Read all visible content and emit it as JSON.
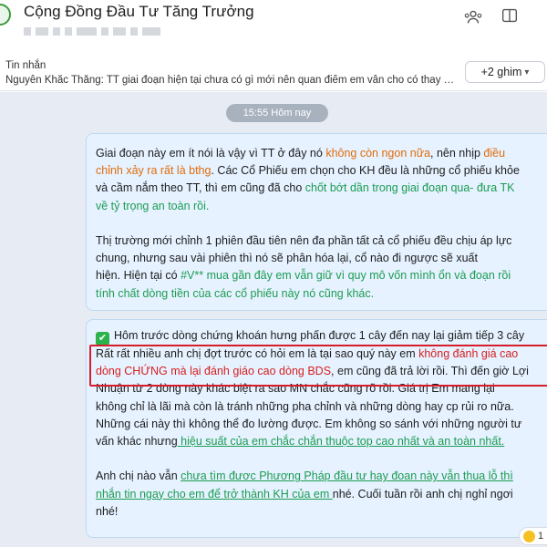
{
  "header": {
    "title": "Cộng Đồng Đầu Tư Tăng Trưởng"
  },
  "pinned": {
    "label": "Tin nhắn",
    "message": "Nguyễn Khắc Thắng: TT giai đoạn hiện tại chưa có gì mới nên quan điểm em vẫn cho có thay đổi....",
    "pin_count_label": "+2 ghim"
  },
  "chat": {
    "timestamp": "15:55 Hôm nay",
    "message1": {
      "l1_a": "Giai đoạn này em ít nói là vậy vì TT ở đây nó ",
      "l1_b": "không còn ngon nữa",
      "l1_c": ", nên nhịp ",
      "l1_d": "điều",
      "l2_a": "chỉnh xảy ra rất là bthg",
      "l2_b": ". Các Cổ Phiếu em chọn cho KH đều là những cổ phiếu khỏe",
      "l3_a": "và cầm nắm theo TT, thì em cũng đã cho ",
      "l3_b": "chốt bớt dần trong giai đoạn qua- đưa TK",
      "l4": "về tỷ trọng an toàn rồi.",
      "l5": "Thị trường mới chỉnh 1 phiên đầu tiên nên đa phần tất cả cổ phiếu đều chịu áp lực",
      "l6": "chung, nhưng sau vài phiên thì nó sẽ phân hóa lại, cổ nào đi ngược sẽ xuất",
      "l7_a": "hiện. Hiện tại có ",
      "l7_b": "#V** mua gần đây em vẫn giữ vì quy mô vốn mình ổn và đoạn rồi",
      "l8": "tính chất dòng tiền của các cổ phiếu này nó cũng khác."
    },
    "message2": {
      "l1": "Hôm trước dòng chứng khoán hưng phấn được 1 cây đến nay lại giảm tiếp 3 cây",
      "l2_a": "Rất rất nhiều anh chị đợt trước có hỏi em là tại sao quý này em ",
      "l2_b": "không đánh giá cao",
      "l3_a": "dòng CHỨNG mà lại đánh giáo cao dòng BDS",
      "l3_b": ", em cũng đã trả lời rồi. Thì đến giờ Lợi",
      "l4": "Nhuận từ 2 dòng này khác biệt ra sao MN chắc cũng rõ rồi. Giá trị Em mang lại",
      "l5": "không chỉ là lãi mà còn là tránh những pha chỉnh và những dòng hay cp rủi ro nữa.",
      "l6": "Những cái này thì không thể đo lường được. Em không so sánh với những người tư",
      "l7_a": "vấn khác nhưng",
      "l7_b": " hiệu suất của em chắc chắn thuộc top cao nhất và an toàn nhất.",
      "l8_a": "Anh chị nào vẫn ",
      "l8_b": "chưa tìm được Phương Pháp đầu tư hay đoạn này vẫn thua lỗ thì",
      "l9_a": "nhắn tin ngay cho em để trở thành KH của em ",
      "l9_b": "nhé. Cuối tuần rồi anh chị nghỉ ngơi",
      "l10": "nhé!"
    },
    "reaction_count": "1"
  },
  "colors": {
    "bubble_bg": "#e6f2ff",
    "chat_bg": "#e7ecf4",
    "highlight_orange": "#e06c0a",
    "highlight_green": "#1c9c52",
    "highlight_red": "#d62020",
    "annotation_box": "#d71d2a"
  },
  "icons": [
    "group-members-icon",
    "tabs-icon",
    "checkmark-icon",
    "emoji-reaction-icon"
  ]
}
